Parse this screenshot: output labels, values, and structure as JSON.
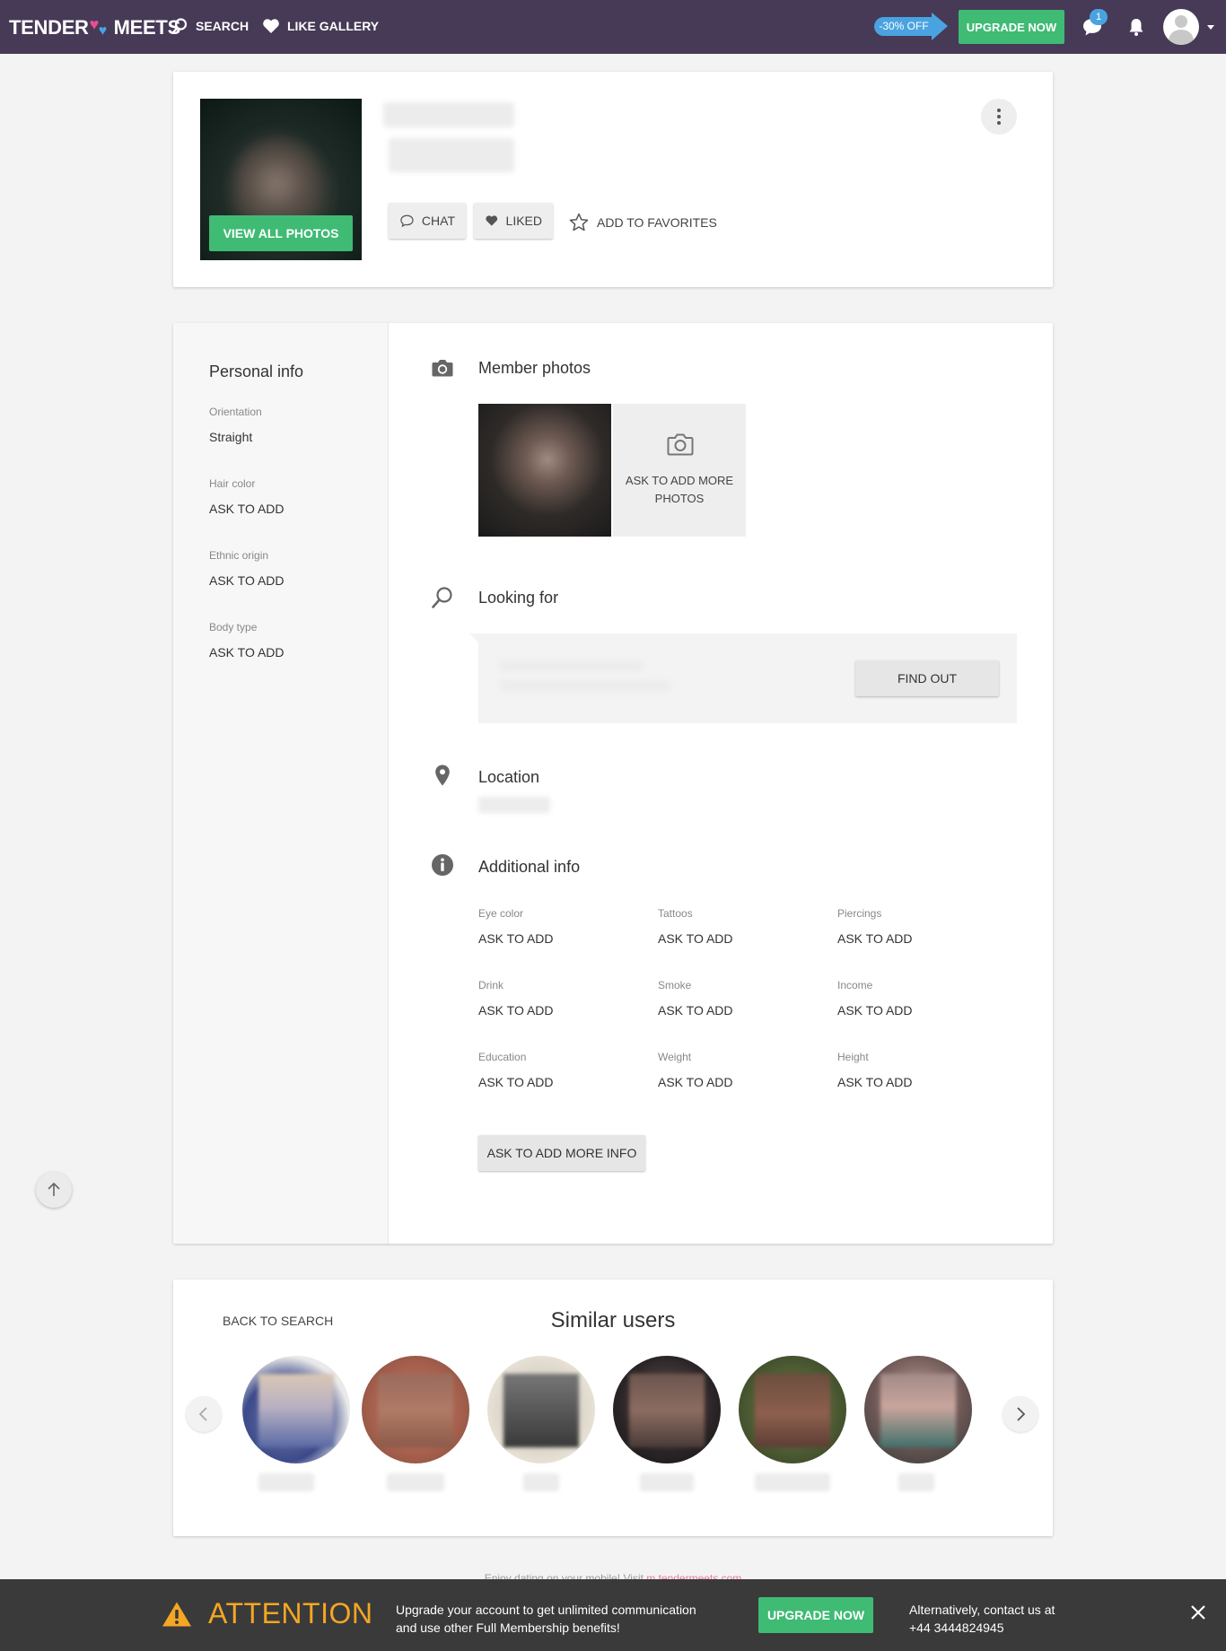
{
  "header": {
    "logo_left": "TENDER",
    "logo_right": "MEETS",
    "nav": [
      {
        "label": "SEARCH",
        "icon": "search-icon"
      },
      {
        "label": "LIKE GALLERY",
        "icon": "heart-icon"
      }
    ],
    "discount_label": "-30% OFF",
    "upgrade_label": "UPGRADE NOW",
    "messages_badge": "1"
  },
  "profile": {
    "view_photos_label": "VIEW ALL PHOTOS",
    "actions": {
      "chat_label": "CHAT",
      "liked_label": "LIKED",
      "favorites_label": "ADD TO FAVORITES"
    }
  },
  "personal_info": {
    "title": "Personal info",
    "fields": [
      {
        "label": "Orientation",
        "value": "Straight"
      },
      {
        "label": "Hair color",
        "value": "ASK TO ADD"
      },
      {
        "label": "Ethnic origin",
        "value": "ASK TO ADD"
      },
      {
        "label": "Body type",
        "value": "ASK TO ADD"
      }
    ]
  },
  "member_photos": {
    "title": "Member photos",
    "ask_more_label": "ASK TO ADD MORE PHOTOS"
  },
  "looking_for": {
    "title": "Looking for",
    "find_out_label": "FIND OUT"
  },
  "location": {
    "title": "Location"
  },
  "additional_info": {
    "title": "Additional info",
    "fields": [
      {
        "label": "Eye color",
        "value": "ASK TO ADD"
      },
      {
        "label": "Tattoos",
        "value": "ASK TO ADD"
      },
      {
        "label": "Piercings",
        "value": "ASK TO ADD"
      },
      {
        "label": "Drink",
        "value": "ASK TO ADD"
      },
      {
        "label": "Smoke",
        "value": "ASK TO ADD"
      },
      {
        "label": "Income",
        "value": "ASK TO ADD"
      },
      {
        "label": "Education",
        "value": "ASK TO ADD"
      },
      {
        "label": "Weight",
        "value": "ASK TO ADD"
      },
      {
        "label": "Height",
        "value": "ASK TO ADD"
      }
    ],
    "more_info_label": "ASK TO ADD MORE INFO"
  },
  "similar": {
    "back_label": "BACK TO SEARCH",
    "title": "Similar users"
  },
  "footer_hint": {
    "text": "Enjoy dating on your mobile! Visit",
    "link": "m.tendermeets.com"
  },
  "attention": {
    "title": "ATTENTION",
    "line1": "Upgrade your account to get unlimited communication",
    "line2": "and use other Full Membership benefits!",
    "upgrade_label": "UPGRADE NOW",
    "contact_line1": "Alternatively, contact us at",
    "contact_line2": "+44 3444824945"
  },
  "colors": {
    "header_bg": "#463a57",
    "accent_green": "#3fbb74",
    "accent_blue": "#4aa3e0",
    "attention_orange": "#f5a623"
  }
}
